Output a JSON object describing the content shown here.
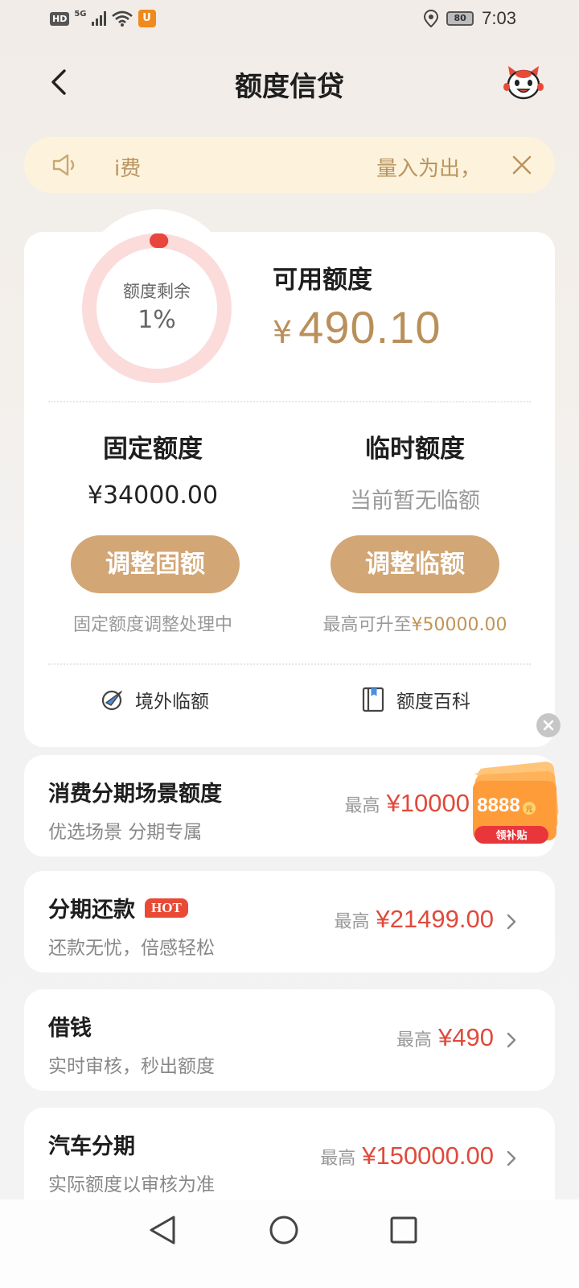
{
  "status_bar": {
    "hd": "HD",
    "network": "5G",
    "battery": "80",
    "time": "7:03"
  },
  "header": {
    "title": "额度信贷"
  },
  "notice": {
    "text_left": "i费",
    "text_right": "量入为出，"
  },
  "summary": {
    "ring_label": "额度剩余",
    "ring_percent": "1%",
    "ring_fraction": 0.01,
    "available_label": "可用额度",
    "currency": "¥",
    "available_amount": "490.10"
  },
  "fixed": {
    "title": "固定额度",
    "value": "¥34000.00",
    "button": "调整固额",
    "note": "固定额度调整处理中"
  },
  "temp": {
    "title": "临时额度",
    "value": "当前暂无临额",
    "button": "调整临额",
    "note_prefix": "最高可升至",
    "note_amount": "¥50000.00"
  },
  "links": {
    "overseas": "境外临额",
    "wiki": "额度百科"
  },
  "list": [
    {
      "title": "消费分期场景额度",
      "subtitle": "优选场景 分期专属",
      "label": "最高",
      "amount": "¥10000"
    },
    {
      "title": "分期还款",
      "badge": "HOT",
      "subtitle": "还款无忧，倍感轻松",
      "label": "最高",
      "amount": "¥21499.00"
    },
    {
      "title": "借钱",
      "subtitle": "实时审核，秒出额度",
      "label": "最高",
      "amount": "¥490"
    },
    {
      "title": "汽车分期",
      "subtitle": "实际额度以审核为准",
      "label": "最高",
      "amount": "¥150000.00"
    }
  ],
  "promo": {
    "amount": "8888",
    "unit": "元",
    "label": "领补贴"
  },
  "colors": {
    "accent_gold": "#d2a675",
    "amount_red": "#e04a3b",
    "ring_red": "#e8453c",
    "notice_bg": "#fdf3dd"
  }
}
